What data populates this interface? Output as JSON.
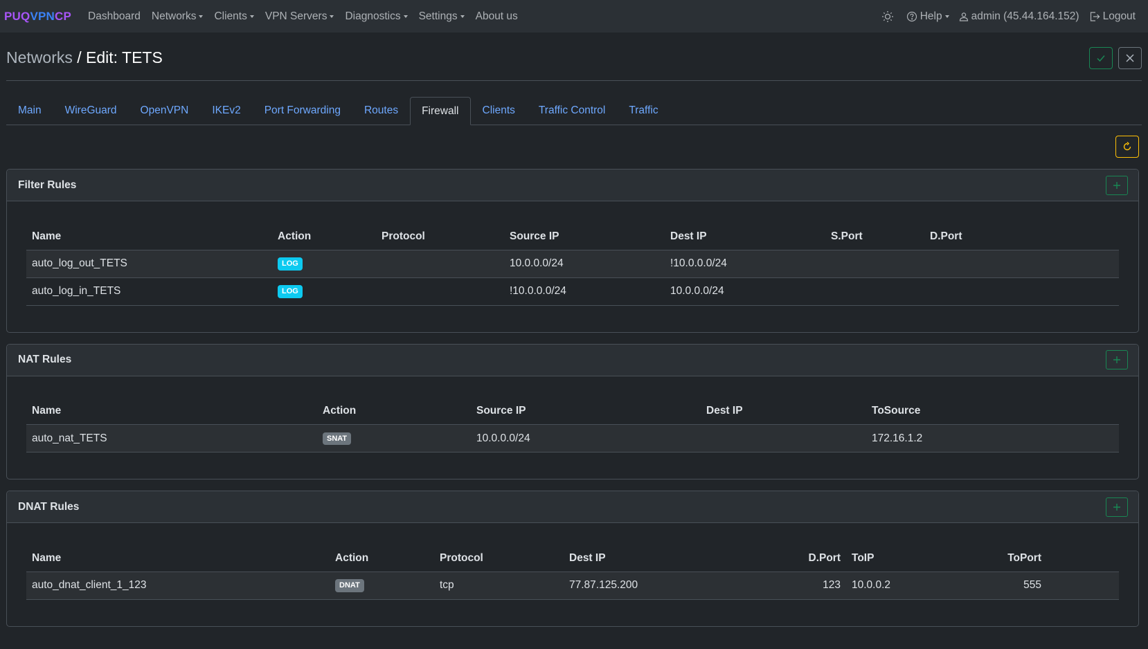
{
  "brand": {
    "p1": "PUQ",
    "p2": "VPN",
    "p3": "CP"
  },
  "nav": {
    "dashboard": "Dashboard",
    "networks": "Networks",
    "clients": "Clients",
    "vpn_servers": "VPN Servers",
    "diagnostics": "Diagnostics",
    "settings": "Settings",
    "about": "About us",
    "help": "Help",
    "user": "admin (45.44.164.152)",
    "logout": "Logout"
  },
  "header": {
    "crumb": "Networks",
    "title": " / Edit: TETS"
  },
  "tabs": [
    {
      "label": "Main"
    },
    {
      "label": "WireGuard"
    },
    {
      "label": "OpenVPN"
    },
    {
      "label": "IKEv2"
    },
    {
      "label": "Port Forwarding"
    },
    {
      "label": "Routes"
    },
    {
      "label": "Firewall"
    },
    {
      "label": "Clients"
    },
    {
      "label": "Traffic Control"
    },
    {
      "label": "Traffic"
    }
  ],
  "filter": {
    "title": "Filter Rules",
    "headers": [
      "Name",
      "Action",
      "Protocol",
      "Source IP",
      "Dest IP",
      "S.Port",
      "D.Port"
    ],
    "rows": [
      {
        "name": "auto_log_out_TETS",
        "action": "LOG",
        "protocol": "",
        "src": "10.0.0.0/24",
        "dst": "!10.0.0.0/24",
        "sport": "",
        "dport": ""
      },
      {
        "name": "auto_log_in_TETS",
        "action": "LOG",
        "protocol": "",
        "src": "!10.0.0.0/24",
        "dst": "10.0.0.0/24",
        "sport": "",
        "dport": ""
      }
    ]
  },
  "nat": {
    "title": "NAT Rules",
    "headers": [
      "Name",
      "Action",
      "Source IP",
      "Dest IP",
      "ToSource"
    ],
    "rows": [
      {
        "name": "auto_nat_TETS",
        "action": "SNAT",
        "src": "10.0.0.0/24",
        "dst": "",
        "tosource": "172.16.1.2"
      }
    ]
  },
  "dnat": {
    "title": "DNAT Rules",
    "headers": [
      "Name",
      "Action",
      "Protocol",
      "Dest IP",
      "D.Port",
      "ToIP",
      "ToPort"
    ],
    "rows": [
      {
        "name": "auto_dnat_client_1_123",
        "action": "DNAT",
        "protocol": "tcp",
        "dst": "77.87.125.200",
        "dport": "123",
        "toip": "10.0.0.2",
        "toport": "555"
      }
    ]
  },
  "colors": {
    "accent": "#6ea8fe",
    "success": "#198754",
    "warning": "#ffc107",
    "info": "#0dcaf0"
  }
}
